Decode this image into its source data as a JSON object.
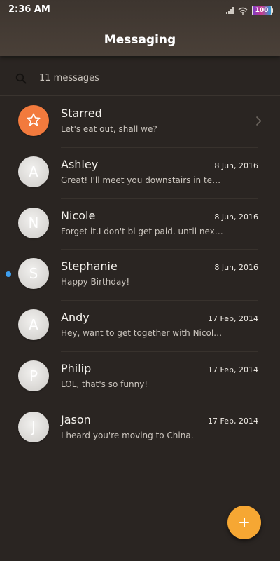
{
  "status_bar": {
    "time": "2:36 AM",
    "battery": "100"
  },
  "header": {
    "title": "Messaging"
  },
  "search": {
    "count_label": "11 messages"
  },
  "conversations": [
    {
      "name": "Starred",
      "preview": "Let's eat out, shall we?",
      "date": "",
      "avatar_letter": ""
    },
    {
      "name": "Ashley",
      "preview": "Great! I'll meet you downstairs in ten ...",
      "date": "8 Jun, 2016",
      "avatar_letter": "A"
    },
    {
      "name": "Nicole",
      "preview": "Forget it.I don't bl get paid. until next F...",
      "date": "8 Jun, 2016",
      "avatar_letter": "N"
    },
    {
      "name": "Stephanie",
      "preview": "Happy Birthday!",
      "date": "8 Jun, 2016",
      "avatar_letter": "S",
      "unread": true
    },
    {
      "name": "Andy",
      "preview": "Hey, want to get together with Nicole ...",
      "date": "17 Feb, 2014",
      "avatar_letter": "A"
    },
    {
      "name": "Philip",
      "preview": "LOL, that's so funny!",
      "date": "17 Feb, 2014",
      "avatar_letter": "P"
    },
    {
      "name": "Jason",
      "preview": "I heard you're moving to China.",
      "date": "17 Feb, 2014",
      "avatar_letter": "J"
    }
  ],
  "icons": {
    "search": "search-icon",
    "star": "star-icon",
    "chevron": "chevron-right-icon",
    "compose": "plus-icon"
  },
  "colors": {
    "starred_avatar": "#f27a3d",
    "fab": "#f6a733",
    "unread_dot": "#3d9eef",
    "background": "#2a2522"
  }
}
